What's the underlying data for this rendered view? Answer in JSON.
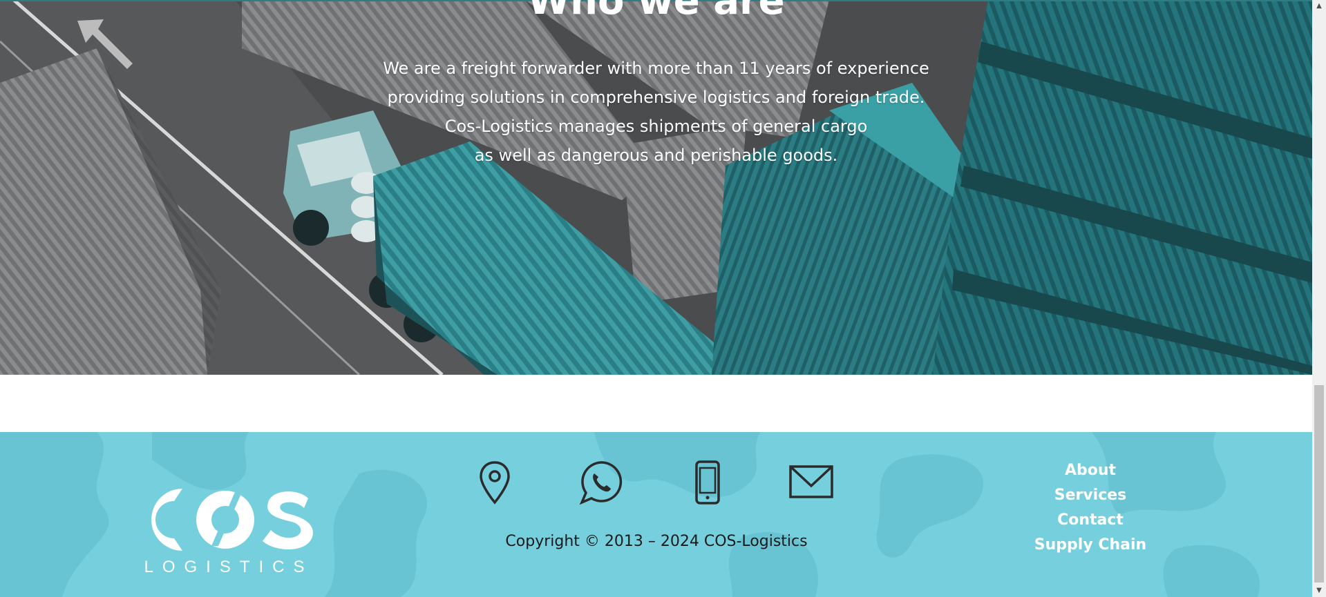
{
  "hero": {
    "title": "Who we are",
    "lines": [
      "We are a freight forwarder with more than 11 years of experience",
      "providing solutions in comprehensive logistics and foreign trade.",
      "Cos-Logistics manages shipments of general cargo",
      "as well as dangerous and perishable goods."
    ]
  },
  "footer": {
    "logo": {
      "main": "COS",
      "sub": "LOGISTICS"
    },
    "contact_icons": [
      "location-pin-icon",
      "whatsapp-icon",
      "mobile-phone-icon",
      "email-envelope-icon"
    ],
    "copyright": "Copyright © 2013 – 2024 COS-Logistics",
    "nav": {
      "about": "About",
      "services": "Services",
      "contact": "Contact",
      "supply_chain": "Supply Chain"
    }
  },
  "scrollbar": {
    "up_icon": "scroll-up-arrow-icon",
    "down_icon": "scroll-down-arrow-icon"
  },
  "colors": {
    "footer_bg": "#75cfdc",
    "teal_overlay": "#2f8d94",
    "hero_text": "#ffffff",
    "icon_stroke": "#2b2b2b"
  }
}
